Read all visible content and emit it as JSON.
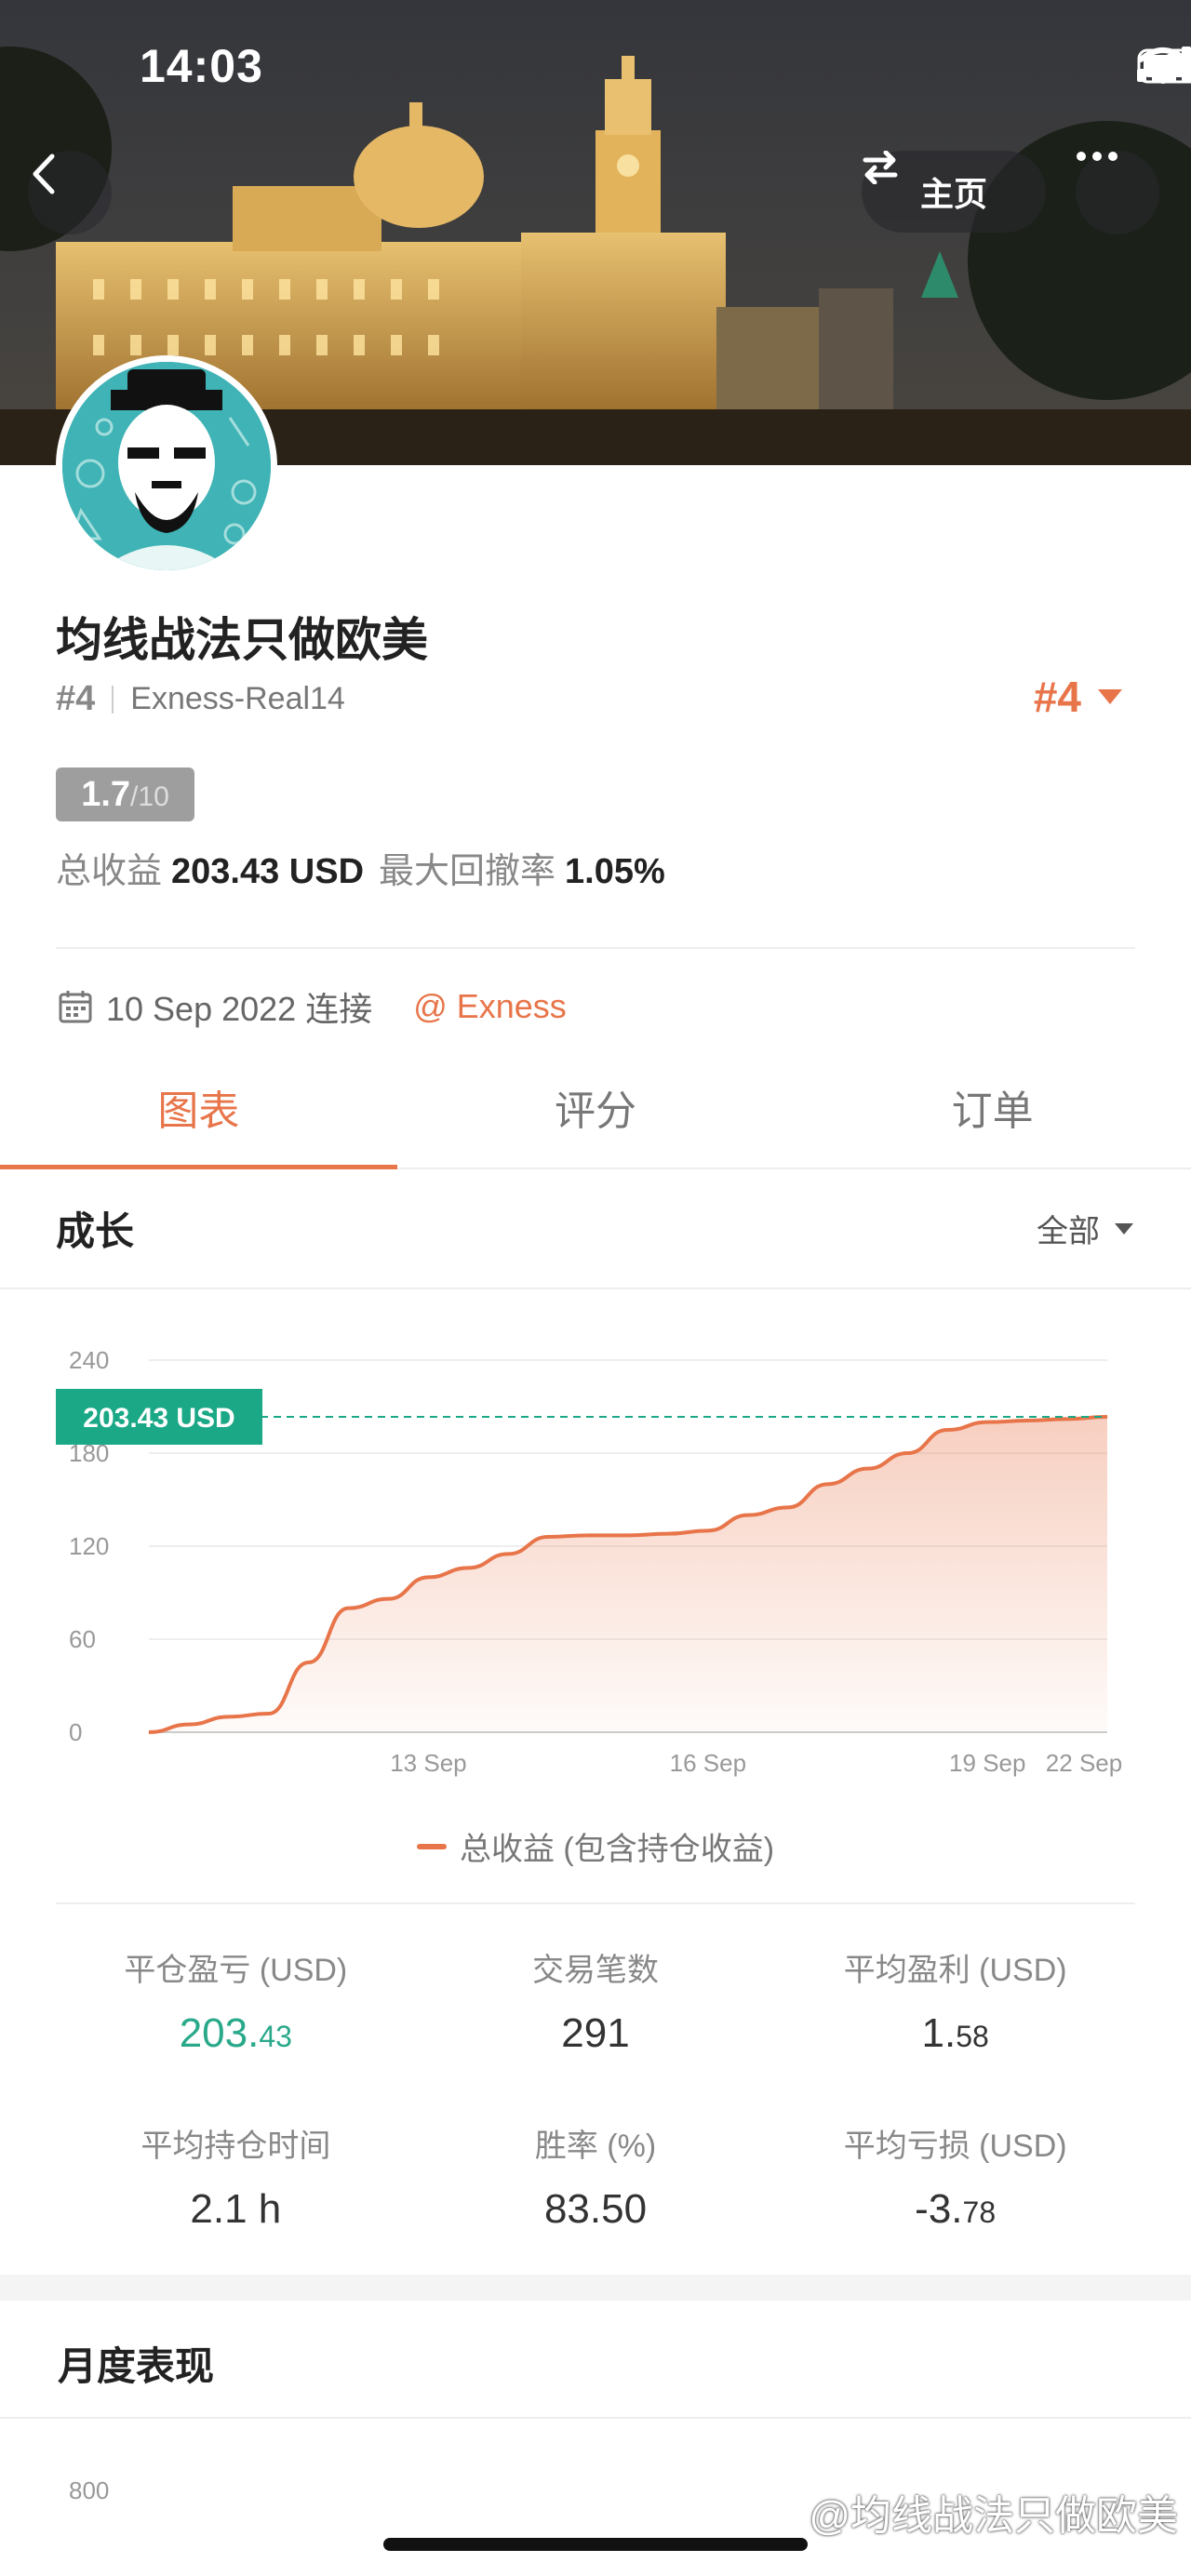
{
  "status_bar": {
    "time": "14:03"
  },
  "header": {
    "home_label": "主页"
  },
  "profile": {
    "name": "均线战法只做欧美",
    "rank": "#4",
    "account": "Exness-Real14",
    "rank_badge": "#4",
    "score_value": "1.7",
    "score_max": "/10",
    "total_profit_label": "总收益",
    "total_profit_value": "203.43 USD",
    "max_drawdown_label": "最大回撤率",
    "max_drawdown_value": "1.05%",
    "connected_date": "10 Sep 2022 连接",
    "broker": "@ Exness"
  },
  "tabs": [
    {
      "label": "图表",
      "active": true
    },
    {
      "label": "评分",
      "active": false
    },
    {
      "label": "订单",
      "active": false
    }
  ],
  "growth": {
    "title": "成长",
    "range_label": "全部"
  },
  "chart_data": {
    "type": "area",
    "x_tick_labels": [
      "13 Sep",
      "16 Sep",
      "19 Sep",
      "22 Sep"
    ],
    "y_ticks": [
      0,
      60,
      120,
      180,
      240
    ],
    "ylim": [
      0,
      240
    ],
    "current_value_label": "203.43 USD",
    "current_value": 203.43,
    "series": [
      {
        "name": "总收益 (包含持仓收益)",
        "x": [
          0,
          0.5,
          1.0,
          1.5,
          2.0,
          2.5,
          3.0,
          3.5,
          4.0,
          4.5,
          5.0,
          5.5,
          6.0,
          6.5,
          7.0,
          7.5,
          8.0,
          8.5,
          9.0,
          9.5,
          10.0,
          10.5,
          11.0,
          11.5,
          12.0
        ],
        "values": [
          0,
          5,
          10,
          12,
          45,
          80,
          86,
          100,
          106,
          115,
          126,
          127,
          127,
          128,
          130,
          140,
          145,
          160,
          170,
          180,
          195,
          200,
          201,
          202,
          203.43
        ]
      }
    ],
    "color": "#e8754a",
    "label_color": "#1aa886"
  },
  "legend": {
    "label": "总收益 (包含持仓收益)"
  },
  "kpis": [
    {
      "label": "平仓盈亏 (USD)",
      "value_main": "203.",
      "value_small": "43",
      "highlight": true
    },
    {
      "label": "交易笔数",
      "value_main": "291",
      "value_small": ""
    },
    {
      "label": "平均盈利 (USD)",
      "value_main": "1.",
      "value_small": "58"
    },
    {
      "label": "平均持仓时间",
      "value_main": "2.1 h",
      "value_small": ""
    },
    {
      "label": "胜率 (%)",
      "value_main": "83.50",
      "value_small": ""
    },
    {
      "label": "平均亏损 (USD)",
      "value_main": "-3.",
      "value_small": "78"
    }
  ],
  "monthly": {
    "title": "月度表现",
    "first_tick": "800"
  },
  "watermark": {
    "text": "@均线战法只做欧美"
  }
}
